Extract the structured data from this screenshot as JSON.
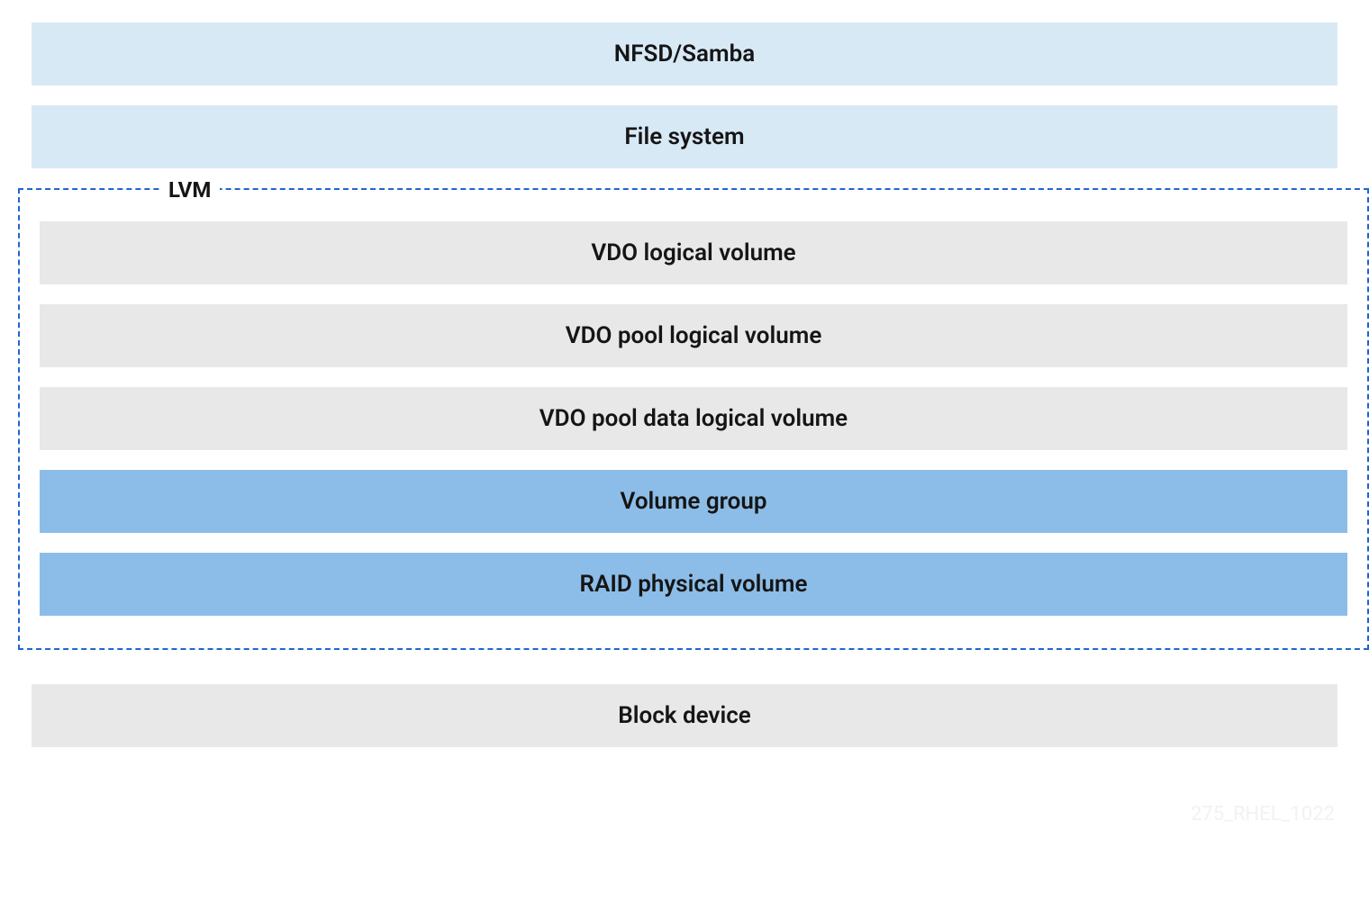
{
  "layers": {
    "nfsd_samba": "NFSD/Samba",
    "file_system": "File system",
    "block_device": "Block device"
  },
  "lvm": {
    "label": "LVM",
    "layers": {
      "vdo_logical_volume": "VDO logical volume",
      "vdo_pool_logical_volume": "VDO pool logical volume",
      "vdo_pool_data_logical_volume": "VDO pool data logical volume",
      "volume_group": "Volume group",
      "raid_physical_volume": "RAID physical volume"
    }
  },
  "footer_id": "275_RHEL_1022"
}
